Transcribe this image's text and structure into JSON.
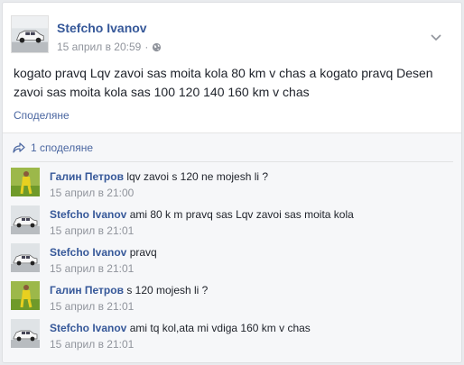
{
  "post": {
    "author": "Stefcho Ivanov",
    "date": "15 април в 20:59",
    "separator": "·",
    "text": "kogato pravq Lqv zavoi sas moita kola 80 km v chas a kogato pravq Desen zavoi sas moita kola sas 100 120 140 160 km v chas",
    "share_label": "Споделяне",
    "share_count_label": "1 споделяне",
    "icons": {
      "privacy": "globe-icon",
      "menu": "chevron-down-icon",
      "shares": "share-arrow-icon"
    }
  },
  "comments": [
    {
      "author": "Галин Петров",
      "text": "lqv zavoi s 120 ne mojesh li ?",
      "time": "15 април в 21:00",
      "avatar": "grass"
    },
    {
      "author": "Stefcho Ivanov",
      "text": "ami 80 k m pravq sas Lqv zavoi sas moita kola",
      "time": "15 април в 21:01",
      "avatar": "car"
    },
    {
      "author": "Stefcho Ivanov",
      "text": "pravq",
      "time": "15 април в 21:01",
      "avatar": "car"
    },
    {
      "author": "Галин Петров",
      "text": "s 120 mojesh li ?",
      "time": "15 април в 21:01",
      "avatar": "grass"
    },
    {
      "author": "Stefcho Ivanov",
      "text": "ami tq kol,ata mi vdiga 160 km v chas",
      "time": "15 април в 21:01",
      "avatar": "car"
    }
  ],
  "colors": {
    "link": "#365899",
    "meta": "#90949c",
    "feedback_bg": "#f6f7f9"
  }
}
